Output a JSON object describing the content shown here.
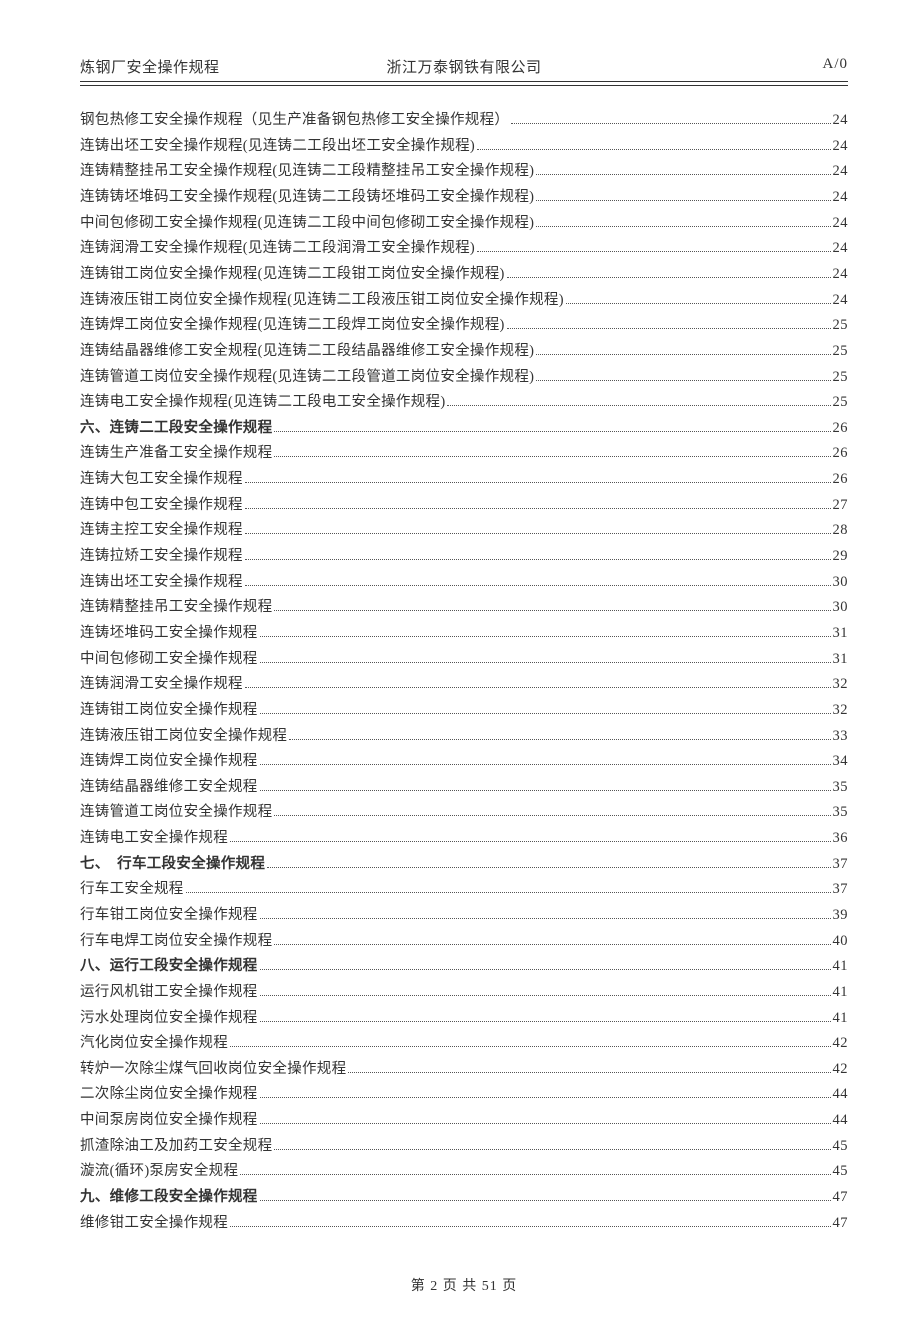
{
  "header": {
    "left": "炼钢厂安全操作规程",
    "center": "浙江万泰钢铁有限公司",
    "right": "A/0"
  },
  "toc": [
    {
      "text": "钢包热修工安全操作规程（见生产准备钢包热修工安全操作规程）",
      "page": "24",
      "bold": false
    },
    {
      "text": "连铸出坯工安全操作规程(见连铸二工段出坯工安全操作规程)",
      "page": "24",
      "bold": false
    },
    {
      "text": "连铸精整挂吊工安全操作规程(见连铸二工段精整挂吊工安全操作规程)",
      "page": "24",
      "bold": false
    },
    {
      "text": "连铸铸坯堆码工安全操作规程(见连铸二工段铸坯堆码工安全操作规程)",
      "page": "24",
      "bold": false
    },
    {
      "text": "中间包修砌工安全操作规程(见连铸二工段中间包修砌工安全操作规程)",
      "page": "24",
      "bold": false
    },
    {
      "text": "连铸润滑工安全操作规程(见连铸二工段润滑工安全操作规程)",
      "page": "24",
      "bold": false
    },
    {
      "text": "连铸钳工岗位安全操作规程(见连铸二工段钳工岗位安全操作规程)",
      "page": "24",
      "bold": false
    },
    {
      "text": "连铸液压钳工岗位安全操作规程(见连铸二工段液压钳工岗位安全操作规程)",
      "page": "24",
      "bold": false
    },
    {
      "text": "连铸焊工岗位安全操作规程(见连铸二工段焊工岗位安全操作规程)",
      "page": "25",
      "bold": false
    },
    {
      "text": "连铸结晶器维修工安全规程(见连铸二工段结晶器维修工安全操作规程)",
      "page": "25",
      "bold": false
    },
    {
      "text": "连铸管道工岗位安全操作规程(见连铸二工段管道工岗位安全操作规程)",
      "page": "25",
      "bold": false
    },
    {
      "text": "连铸电工安全操作规程(见连铸二工段电工安全操作规程)",
      "page": "25",
      "bold": false
    },
    {
      "text": "六、连铸二工段安全操作规程",
      "page": "26",
      "bold": true
    },
    {
      "text": "连铸生产准备工安全操作规程",
      "page": "26",
      "bold": false
    },
    {
      "text": "连铸大包工安全操作规程",
      "page": "26",
      "bold": false
    },
    {
      "text": "连铸中包工安全操作规程",
      "page": "27",
      "bold": false
    },
    {
      "text": "连铸主控工安全操作规程",
      "page": "28",
      "bold": false
    },
    {
      "text": "连铸拉矫工安全操作规程",
      "page": "29",
      "bold": false
    },
    {
      "text": "连铸出坯工安全操作规程",
      "page": "30",
      "bold": false
    },
    {
      "text": "连铸精整挂吊工安全操作规程",
      "page": "30",
      "bold": false
    },
    {
      "text": "连铸坯堆码工安全操作规程",
      "page": "31",
      "bold": false
    },
    {
      "text": "中间包修砌工安全操作规程",
      "page": "31",
      "bold": false
    },
    {
      "text": "连铸润滑工安全操作规程",
      "page": "32",
      "bold": false
    },
    {
      "text": "连铸钳工岗位安全操作规程",
      "page": "32",
      "bold": false
    },
    {
      "text": "连铸液压钳工岗位安全操作规程",
      "page": "33",
      "bold": false
    },
    {
      "text": "连铸焊工岗位安全操作规程",
      "page": "34",
      "bold": false
    },
    {
      "text": "连铸结晶器维修工安全规程",
      "page": "35",
      "bold": false
    },
    {
      "text": "连铸管道工岗位安全操作规程",
      "page": "35",
      "bold": false
    },
    {
      "text": "连铸电工安全操作规程",
      "page": "36",
      "bold": false
    },
    {
      "text": "七、　行车工段安全操作规程",
      "page": "37",
      "bold": true
    },
    {
      "text": "行车工安全规程",
      "page": "37",
      "bold": false
    },
    {
      "text": "行车钳工岗位安全操作规程",
      "page": "39",
      "bold": false
    },
    {
      "text": "行车电焊工岗位安全操作规程",
      "page": "40",
      "bold": false
    },
    {
      "text": "八、运行工段安全操作规程",
      "page": "41",
      "bold": true
    },
    {
      "text": "运行风机钳工安全操作规程",
      "page": "41",
      "bold": false
    },
    {
      "text": "污水处理岗位安全操作规程",
      "page": "41",
      "bold": false
    },
    {
      "text": "汽化岗位安全操作规程",
      "page": "42",
      "bold": false
    },
    {
      "text": "转炉一次除尘煤气回收岗位安全操作规程",
      "page": "42",
      "bold": false
    },
    {
      "text": "二次除尘岗位安全操作规程",
      "page": "44",
      "bold": false
    },
    {
      "text": "中间泵房岗位安全操作规程",
      "page": "44",
      "bold": false
    },
    {
      "text": "抓渣除油工及加药工安全规程",
      "page": "45",
      "bold": false
    },
    {
      "text": "漩流(循环)泵房安全规程",
      "page": "45",
      "bold": false
    },
    {
      "text": "九、维修工段安全操作规程",
      "page": "47",
      "bold": true
    },
    {
      "text": "维修钳工安全操作规程",
      "page": "47",
      "bold": false
    }
  ],
  "footer": {
    "prefix": "第",
    "page": "2",
    "mid": "页 共",
    "total": "51",
    "suffix": "页"
  }
}
